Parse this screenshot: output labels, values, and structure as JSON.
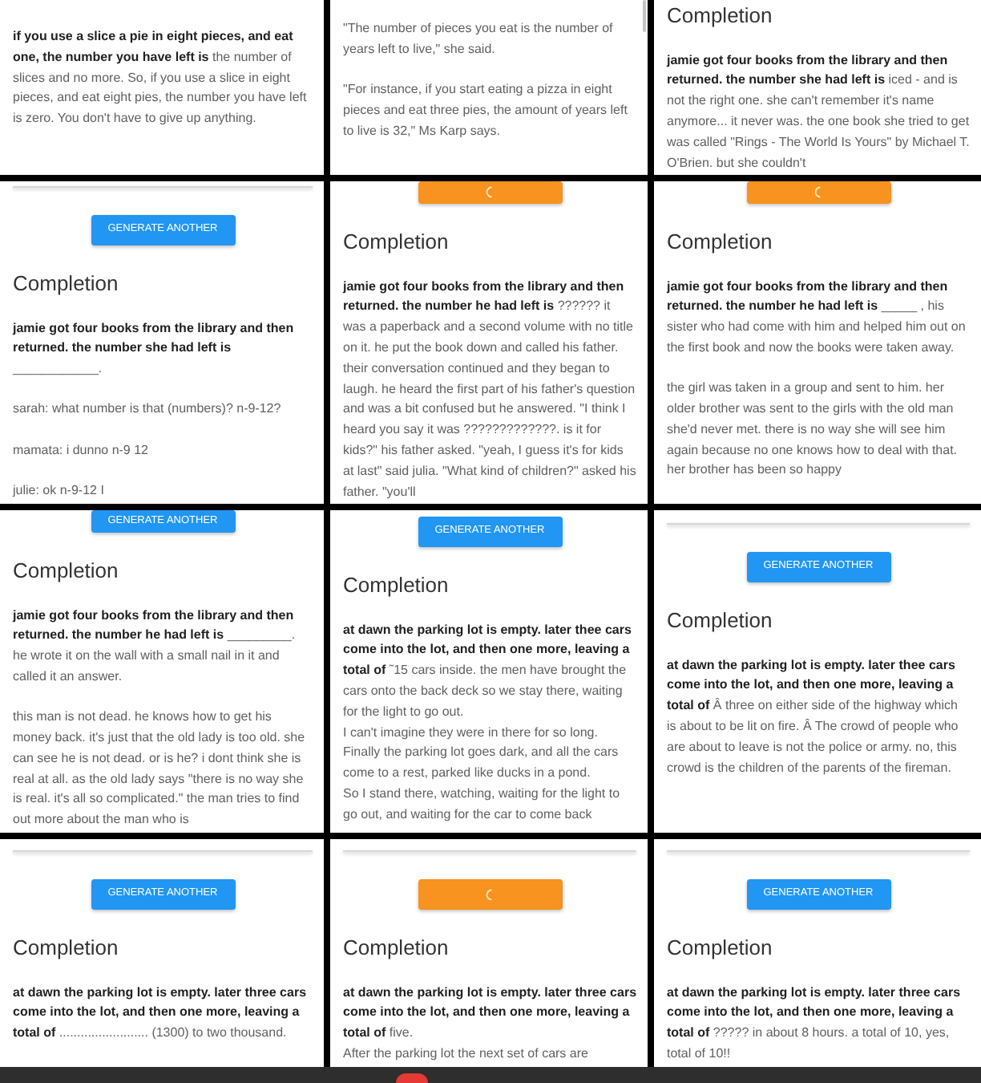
{
  "panels": [
    {
      "prompt": "if you use a slice a pie in eight pieces, and eat one, the number you have left is",
      "completion": [
        "the number of slices and no more. So, if you use a slice in eight pieces, and eat eight pies, the number you have left is zero. You don't have to give up anything."
      ]
    },
    {
      "completion": [
        "\"The number of pieces you eat is the number of years left to live,\" she said.",
        "\"For instance, if you start eating a pizza in eight pieces and eat three pies, the amount of years left to live is 32,\" Ms Karp says."
      ]
    },
    {
      "heading": "Completion",
      "prompt": "jamie got four books from the library and then returned. the number she had left is",
      "completion": [
        "iced - and is not the right one. she can't remember it's name anymore... it never was. the one book she tried to get was called \"Rings - The World Is Yours\" by Michael T. O'Brien. but she couldn't"
      ]
    },
    {
      "button": {
        "label": "GENERATE ANOTHER",
        "loading": false
      },
      "heading": "Completion",
      "prompt": "jamie got four books from the library and then returned. the number she had left is",
      "completion": [
        "____________.",
        "sarah: what number is that (numbers)? n-9-12?",
        "mamata: i dunno n-9 12",
        "julie: ok n-9-12 I"
      ]
    },
    {
      "button": {
        "loading": true
      },
      "heading": "Completion",
      "prompt": "jamie got four books from the library and then returned. the number he had left is",
      "completion": [
        "?????? it was a paperback and a second volume with no title on it. he put the book down and called his father. their conversation continued and they began to laugh. he heard the first part of his father's question and was a bit confused but he answered. \"I think I heard you say it was ?????????????. is it for kids?\" his father asked. \"yeah, I guess it's for kids at last\" said julia. \"What kind of children?\" asked his father. \"you'll"
      ]
    },
    {
      "button": {
        "loading": true
      },
      "heading": "Completion",
      "prompt": "jamie got four books from the library and then returned. the number he had left is",
      "completion": [
        "_____ , his sister who had come with him and helped him out on the first book and now the books were taken away.",
        "the girl was taken in a group and sent to him. her older brother was sent to the girls with the old man she'd never met. there is no way she will see him again because no one knows how to deal with that. her brother has been so happy"
      ]
    },
    {
      "button": {
        "label": "GENERATE ANOTHER",
        "loading": false
      },
      "heading": "Completion",
      "prompt": "jamie got four books from the library and then returned. the number he had left is",
      "completion": [
        "_________. he wrote it on the wall with a small nail in it and called it an answer.",
        "this man is not dead. he knows how to get his money back. it's just that the old lady is too old. she can see he is not dead. or is he? i dont think she is real at all. as the old lady says \"there is no way she is real. it's all so complicated.\" the man tries to find out more about the man who is"
      ]
    },
    {
      "button": {
        "label": "GENERATE ANOTHER",
        "loading": false
      },
      "heading": "Completion",
      "prompt": "at dawn the parking lot is empty. later thee cars come into the lot, and then one more, leaving a total of",
      "completion": [
        "˜15 cars inside. the men have brought the cars onto the back deck so we stay there, waiting for the light to go out.\nI can't imagine they were in there for so long.\nFinally the parking lot goes dark, and all the cars come to a rest, parked like ducks in a pond.\nSo I stand there, watching, waiting for the light to go out, and waiting for the car to come back"
      ]
    },
    {
      "button": {
        "label": "GENERATE ANOTHER",
        "loading": false
      },
      "heading": "Completion",
      "prompt": "at dawn the parking lot is empty. later thee cars come into the lot, and then one more, leaving a total of",
      "completion": [
        "Â three on either side of the highway which is about to be lit on fire. Â The crowd of people who are about to leave is not the police or army. no, this crowd is the children of the parents of the fireman."
      ]
    },
    {
      "button": {
        "label": "GENERATE ANOTHER",
        "loading": false
      },
      "heading": "Completion",
      "prompt": "at dawn the parking lot is empty. later three cars come into the lot, and then one more, leaving a total of",
      "completion": [
        "......................... (1300) to two thousand."
      ]
    },
    {
      "button": {
        "loading": true
      },
      "heading": "Completion",
      "prompt": "at dawn the parking lot is empty. later three cars come into the lot, and then one more, leaving a total of",
      "completion": [
        "five.\nAfter the parking lot the next set of cars are"
      ]
    },
    {
      "button": {
        "label": "GENERATE ANOTHER",
        "loading": false
      },
      "heading": "Completion",
      "prompt": "at dawn the parking lot is empty. later three cars come into the lot, and then one more, leaving a total of",
      "completion": [
        "????? in about 8 hours. a total of 10, yes, total of 10!!"
      ]
    }
  ]
}
